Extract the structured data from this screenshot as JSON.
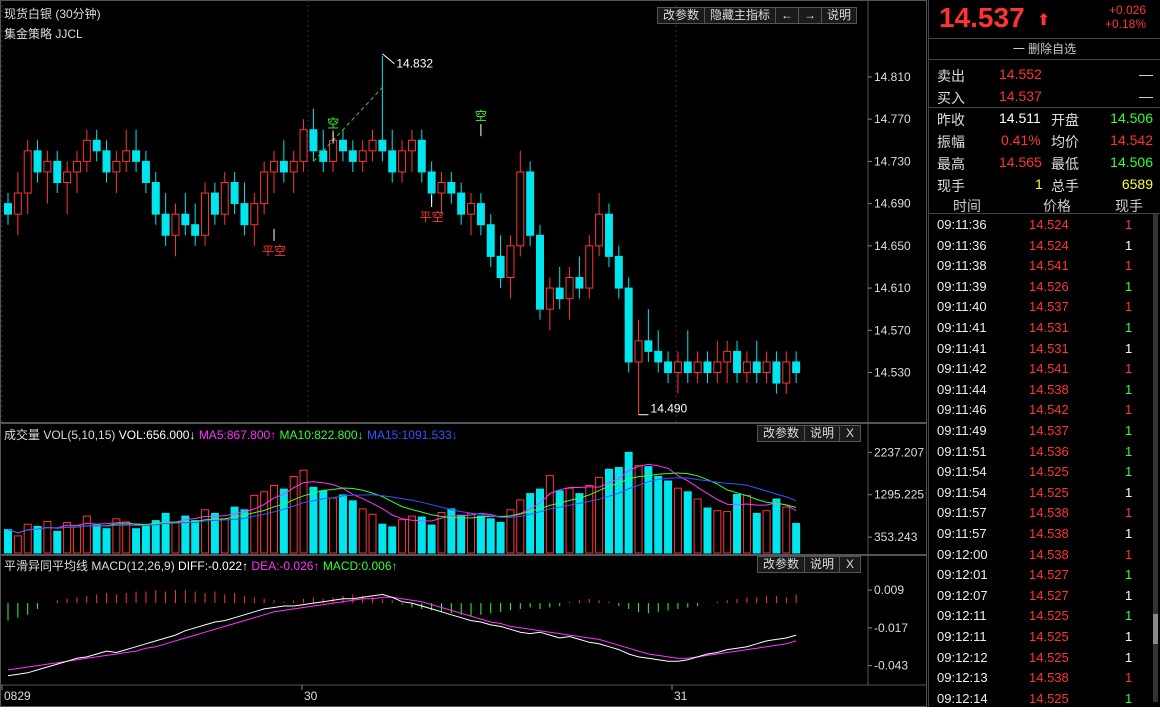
{
  "header": {
    "title": "现货白银 (30分钟)",
    "strategy": "集金策略 JJCL",
    "buttons": {
      "edit_params": "改参数",
      "hide_indicator": "隐藏主指标",
      "left": "←",
      "right": "→",
      "help": "说明"
    }
  },
  "main_axis": {
    "ticks": [
      "14.810",
      "14.770",
      "14.730",
      "14.690",
      "14.650",
      "14.610",
      "14.570",
      "14.530"
    ]
  },
  "annotations": {
    "high_label": "14.832",
    "low_label": "14.490",
    "signal_short": "空",
    "signal_flat_short": "平空"
  },
  "volume_pane": {
    "title_prefix": "成交量 VOL(5,10,15)",
    "vol": "VOL:656.000↓",
    "ma5": "MA5:867.800↑",
    "ma10": "MA10:822.800↓",
    "ma15": "MA15:1091.533↓",
    "buttons": {
      "edit_params": "改参数",
      "help": "说明",
      "close": "X"
    },
    "ticks": [
      "2237.207",
      "1295.225",
      "353.243"
    ]
  },
  "macd_pane": {
    "title_prefix": "平滑异同平均线 MACD(12,26,9)",
    "diff": "DIFF:-0.022↑",
    "dea": "DEA:-0.026↑",
    "macd": "MACD:0.006↑",
    "buttons": {
      "edit_params": "改参数",
      "help": "说明",
      "close": "X"
    },
    "ticks": [
      "0.009",
      "-0.017",
      "-0.043"
    ]
  },
  "date_axis": [
    "0829",
    "30",
    "31"
  ],
  "colors": {
    "up": "#ff3333",
    "down": "#00e5ee",
    "ma5": "#ff33ff",
    "ma10": "#33ff33",
    "ma15": "#3355ff",
    "white": "#ffffff"
  },
  "quote": {
    "price": "14.537",
    "arrow": "⬆",
    "change": "+0.026",
    "change_pct": "+0.18%",
    "delete_fav": "一 删除自选",
    "sell_label": "卖出",
    "sell_price": "14.552",
    "sell_vol": "—",
    "buy_label": "买入",
    "buy_price": "14.537",
    "buy_vol": "—",
    "prev_close_label": "昨收",
    "prev_close": "14.511",
    "open_label": "开盘",
    "open": "14.506",
    "amplitude_label": "振幅",
    "amplitude": "0.41%",
    "avg_label": "均价",
    "avg": "14.542",
    "high_label": "最高",
    "high": "14.565",
    "low_label": "最低",
    "low": "14.506",
    "cur_vol_label": "现手",
    "cur_vol": "1",
    "total_vol_label": "总手",
    "total_vol": "6589"
  },
  "ticks_table": {
    "headers": [
      "时间",
      "价格",
      "现手"
    ],
    "rows": [
      {
        "time": "09:11:36",
        "price": "14.524",
        "vol": "1",
        "dir": "up"
      },
      {
        "time": "09:11:36",
        "price": "14.524",
        "vol": "1",
        "dir": "flat"
      },
      {
        "time": "09:11:38",
        "price": "14.541",
        "vol": "1",
        "dir": "up"
      },
      {
        "time": "09:11:39",
        "price": "14.526",
        "vol": "1",
        "dir": "down"
      },
      {
        "time": "09:11:40",
        "price": "14.537",
        "vol": "1",
        "dir": "up"
      },
      {
        "time": "09:11:41",
        "price": "14.531",
        "vol": "1",
        "dir": "down"
      },
      {
        "time": "09:11:41",
        "price": "14.531",
        "vol": "1",
        "dir": "flat"
      },
      {
        "time": "09:11:42",
        "price": "14.541",
        "vol": "1",
        "dir": "up"
      },
      {
        "time": "09:11:44",
        "price": "14.538",
        "vol": "1",
        "dir": "down"
      },
      {
        "time": "09:11:46",
        "price": "14.542",
        "vol": "1",
        "dir": "up"
      },
      {
        "time": "09:11:49",
        "price": "14.537",
        "vol": "1",
        "dir": "down"
      },
      {
        "time": "09:11:51",
        "price": "14.536",
        "vol": "1",
        "dir": "down"
      },
      {
        "time": "09:11:54",
        "price": "14.525",
        "vol": "1",
        "dir": "down"
      },
      {
        "time": "09:11:54",
        "price": "14.525",
        "vol": "1",
        "dir": "flat"
      },
      {
        "time": "09:11:57",
        "price": "14.538",
        "vol": "1",
        "dir": "up"
      },
      {
        "time": "09:11:57",
        "price": "14.538",
        "vol": "1",
        "dir": "flat"
      },
      {
        "time": "09:12:00",
        "price": "14.538",
        "vol": "1",
        "dir": "up"
      },
      {
        "time": "09:12:01",
        "price": "14.527",
        "vol": "1",
        "dir": "down"
      },
      {
        "time": "09:12:07",
        "price": "14.527",
        "vol": "1",
        "dir": "flat"
      },
      {
        "time": "09:12:11",
        "price": "14.525",
        "vol": "1",
        "dir": "down"
      },
      {
        "time": "09:12:11",
        "price": "14.525",
        "vol": "1",
        "dir": "flat"
      },
      {
        "time": "09:12:12",
        "price": "14.525",
        "vol": "1",
        "dir": "flat"
      },
      {
        "time": "09:12:13",
        "price": "14.538",
        "vol": "1",
        "dir": "up"
      },
      {
        "time": "09:12:14",
        "price": "14.525",
        "vol": "1",
        "dir": "down"
      }
    ]
  },
  "chart_data": {
    "type": "candlestick",
    "candles": [
      [
        14.69,
        14.7,
        14.67,
        14.68
      ],
      [
        14.68,
        14.72,
        14.66,
        14.7
      ],
      [
        14.7,
        14.75,
        14.68,
        14.74
      ],
      [
        14.74,
        14.75,
        14.71,
        14.72
      ],
      [
        14.72,
        14.74,
        14.69,
        14.73
      ],
      [
        14.73,
        14.74,
        14.7,
        14.71
      ],
      [
        14.71,
        14.73,
        14.68,
        14.72
      ],
      [
        14.72,
        14.74,
        14.7,
        14.73
      ],
      [
        14.73,
        14.76,
        14.72,
        14.75
      ],
      [
        14.75,
        14.76,
        14.73,
        14.74
      ],
      [
        14.74,
        14.75,
        14.71,
        14.72
      ],
      [
        14.72,
        14.74,
        14.7,
        14.73
      ],
      [
        14.73,
        14.76,
        14.72,
        14.74
      ],
      [
        14.74,
        14.76,
        14.72,
        14.73
      ],
      [
        14.73,
        14.74,
        14.7,
        14.71
      ],
      [
        14.71,
        14.72,
        14.67,
        14.68
      ],
      [
        14.68,
        14.7,
        14.65,
        14.66
      ],
      [
        14.66,
        14.69,
        14.64,
        14.68
      ],
      [
        14.68,
        14.7,
        14.66,
        14.67
      ],
      [
        14.67,
        14.69,
        14.65,
        14.66
      ],
      [
        14.66,
        14.71,
        14.65,
        14.7
      ],
      [
        14.7,
        14.71,
        14.67,
        14.68
      ],
      [
        14.68,
        14.72,
        14.67,
        14.71
      ],
      [
        14.71,
        14.72,
        14.68,
        14.69
      ],
      [
        14.69,
        14.71,
        14.66,
        14.67
      ],
      [
        14.67,
        14.7,
        14.65,
        14.69
      ],
      [
        14.69,
        14.73,
        14.68,
        14.72
      ],
      [
        14.72,
        14.74,
        14.7,
        14.73
      ],
      [
        14.73,
        14.75,
        14.71,
        14.72
      ],
      [
        14.72,
        14.74,
        14.7,
        14.73
      ],
      [
        14.73,
        14.77,
        14.72,
        14.76
      ],
      [
        14.76,
        14.78,
        14.73,
        14.74
      ],
      [
        14.74,
        14.76,
        14.72,
        14.73
      ],
      [
        14.73,
        14.76,
        14.72,
        14.75
      ],
      [
        14.75,
        14.76,
        14.73,
        14.74
      ],
      [
        14.74,
        14.75,
        14.72,
        14.73
      ],
      [
        14.73,
        14.75,
        14.72,
        14.74
      ],
      [
        14.74,
        14.76,
        14.73,
        14.75
      ],
      [
        14.75,
        14.83,
        14.73,
        14.74
      ],
      [
        14.74,
        14.76,
        14.71,
        14.72
      ],
      [
        14.72,
        14.75,
        14.71,
        14.74
      ],
      [
        14.74,
        14.76,
        14.72,
        14.75
      ],
      [
        14.75,
        14.76,
        14.71,
        14.72
      ],
      [
        14.72,
        14.73,
        14.69,
        14.7
      ],
      [
        14.7,
        14.72,
        14.68,
        14.71
      ],
      [
        14.71,
        14.72,
        14.69,
        14.7
      ],
      [
        14.7,
        14.71,
        14.67,
        14.68
      ],
      [
        14.68,
        14.7,
        14.66,
        14.69
      ],
      [
        14.69,
        14.7,
        14.66,
        14.67
      ],
      [
        14.67,
        14.68,
        14.63,
        14.64
      ],
      [
        14.64,
        14.66,
        14.61,
        14.62
      ],
      [
        14.62,
        14.66,
        14.6,
        14.65
      ],
      [
        14.65,
        14.74,
        14.64,
        14.72
      ],
      [
        14.72,
        14.73,
        14.65,
        14.66
      ],
      [
        14.66,
        14.67,
        14.58,
        14.59
      ],
      [
        14.59,
        14.62,
        14.57,
        14.61
      ],
      [
        14.61,
        14.63,
        14.59,
        14.6
      ],
      [
        14.6,
        14.63,
        14.58,
        14.62
      ],
      [
        14.62,
        14.64,
        14.6,
        14.61
      ],
      [
        14.61,
        14.66,
        14.6,
        14.65
      ],
      [
        14.65,
        14.7,
        14.64,
        14.68
      ],
      [
        14.68,
        14.69,
        14.63,
        14.64
      ],
      [
        14.64,
        14.65,
        14.6,
        14.61
      ],
      [
        14.61,
        14.62,
        14.53,
        14.54
      ],
      [
        14.54,
        14.58,
        14.49,
        14.56
      ],
      [
        14.56,
        14.59,
        14.54,
        14.55
      ],
      [
        14.55,
        14.57,
        14.53,
        14.54
      ],
      [
        14.54,
        14.55,
        14.52,
        14.53
      ],
      [
        14.53,
        14.55,
        14.51,
        14.54
      ],
      [
        14.54,
        14.57,
        14.52,
        14.53
      ],
      [
        14.53,
        14.55,
        14.52,
        14.54
      ],
      [
        14.54,
        14.55,
        14.52,
        14.53
      ],
      [
        14.53,
        14.56,
        14.52,
        14.54
      ],
      [
        14.54,
        14.56,
        14.52,
        14.55
      ],
      [
        14.55,
        14.56,
        14.52,
        14.53
      ],
      [
        14.53,
        14.55,
        14.52,
        14.54
      ],
      [
        14.54,
        14.56,
        14.52,
        14.53
      ],
      [
        14.53,
        14.55,
        14.52,
        14.54
      ],
      [
        14.54,
        14.55,
        14.51,
        14.52
      ],
      [
        14.52,
        14.55,
        14.51,
        14.54
      ],
      [
        14.54,
        14.55,
        14.52,
        14.53
      ]
    ],
    "volume": [
      520,
      380,
      640,
      590,
      700,
      480,
      680,
      610,
      820,
      620,
      540,
      760,
      690,
      540,
      600,
      720,
      880,
      690,
      820,
      720,
      960,
      880,
      760,
      1020,
      960,
      1280,
      1360,
      1500,
      1420,
      1700,
      1840,
      1460,
      1380,
      1220,
      1290,
      1160,
      980,
      860,
      640,
      580,
      740,
      820,
      800,
      620,
      900,
      980,
      840,
      880,
      820,
      760,
      680,
      960,
      1180,
      1320,
      1420,
      1720,
      1380,
      1440,
      1320,
      1500,
      1680,
      1860,
      1900,
      2237,
      1940,
      1920,
      1700,
      1600,
      1440,
      1360,
      1200,
      1000,
      940,
      920,
      1300,
      1280,
      880,
      940,
      1200,
      1020,
      656
    ],
    "volume_ylim": [
      0,
      2400
    ],
    "macd_hist": [
      -0.012,
      -0.01,
      -0.008,
      -0.004,
      0.0,
      0.002,
      0.003,
      0.004,
      0.005,
      0.006,
      0.007,
      0.006,
      0.007,
      0.008,
      0.008,
      0.009,
      0.008,
      0.009,
      0.009,
      0.008,
      0.007,
      0.008,
      0.006,
      0.007,
      0.005,
      0.004,
      0.003,
      0.002,
      0.001,
      0.002,
      0.003,
      0.004,
      0.003,
      0.004,
      0.005,
      0.006,
      0.005,
      0.004,
      0.003,
      0.002,
      -0.001,
      -0.003,
      -0.004,
      -0.005,
      -0.006,
      -0.007,
      -0.008,
      -0.009,
      -0.008,
      -0.007,
      -0.006,
      -0.005,
      -0.004,
      -0.003,
      -0.004,
      -0.003,
      -0.002,
      0.001,
      0.002,
      0.003,
      0.002,
      0.001,
      -0.002,
      -0.004,
      -0.006,
      -0.007,
      -0.006,
      -0.005,
      -0.004,
      -0.003,
      -0.002,
      0.0,
      0.001,
      0.002,
      0.003,
      0.004,
      0.004,
      0.005,
      0.005,
      0.004,
      0.006
    ],
    "macd_diff": [
      -0.05,
      -0.049,
      -0.048,
      -0.046,
      -0.044,
      -0.042,
      -0.04,
      -0.038,
      -0.037,
      -0.035,
      -0.033,
      -0.034,
      -0.032,
      -0.03,
      -0.028,
      -0.026,
      -0.024,
      -0.022,
      -0.019,
      -0.017,
      -0.015,
      -0.013,
      -0.012,
      -0.01,
      -0.008,
      -0.006,
      -0.004,
      -0.003,
      -0.002,
      -0.002,
      -0.001,
      0.0,
      0.001,
      0.002,
      0.003,
      0.003,
      0.004,
      0.005,
      0.006,
      0.004,
      0.001,
      0.0,
      -0.002,
      -0.004,
      -0.006,
      -0.008,
      -0.01,
      -0.012,
      -0.013,
      -0.015,
      -0.016,
      -0.018,
      -0.02,
      -0.021,
      -0.02,
      -0.022,
      -0.024,
      -0.023,
      -0.025,
      -0.027,
      -0.028,
      -0.03,
      -0.032,
      -0.035,
      -0.037,
      -0.038,
      -0.039,
      -0.04,
      -0.04,
      -0.039,
      -0.037,
      -0.035,
      -0.034,
      -0.032,
      -0.031,
      -0.03,
      -0.028,
      -0.026,
      -0.025,
      -0.024,
      -0.022
    ],
    "macd_dea": [
      -0.046,
      -0.045,
      -0.044,
      -0.043,
      -0.042,
      -0.041,
      -0.04,
      -0.039,
      -0.038,
      -0.037,
      -0.036,
      -0.035,
      -0.034,
      -0.033,
      -0.031,
      -0.03,
      -0.028,
      -0.026,
      -0.024,
      -0.022,
      -0.02,
      -0.018,
      -0.016,
      -0.014,
      -0.012,
      -0.01,
      -0.008,
      -0.006,
      -0.005,
      -0.004,
      -0.003,
      -0.002,
      -0.001,
      0.0,
      0.001,
      0.002,
      0.003,
      0.003,
      0.004,
      0.004,
      0.003,
      0.002,
      0.001,
      -0.001,
      -0.003,
      -0.005,
      -0.007,
      -0.009,
      -0.011,
      -0.013,
      -0.014,
      -0.016,
      -0.017,
      -0.018,
      -0.019,
      -0.02,
      -0.021,
      -0.022,
      -0.023,
      -0.024,
      -0.025,
      -0.027,
      -0.029,
      -0.031,
      -0.033,
      -0.035,
      -0.036,
      -0.037,
      -0.038,
      -0.038,
      -0.037,
      -0.036,
      -0.035,
      -0.034,
      -0.033,
      -0.032,
      -0.031,
      -0.03,
      -0.029,
      -0.028,
      -0.026
    ],
    "macd_ylim": [
      -0.055,
      0.018
    ],
    "price_ylim": [
      14.485,
      14.845
    ]
  }
}
